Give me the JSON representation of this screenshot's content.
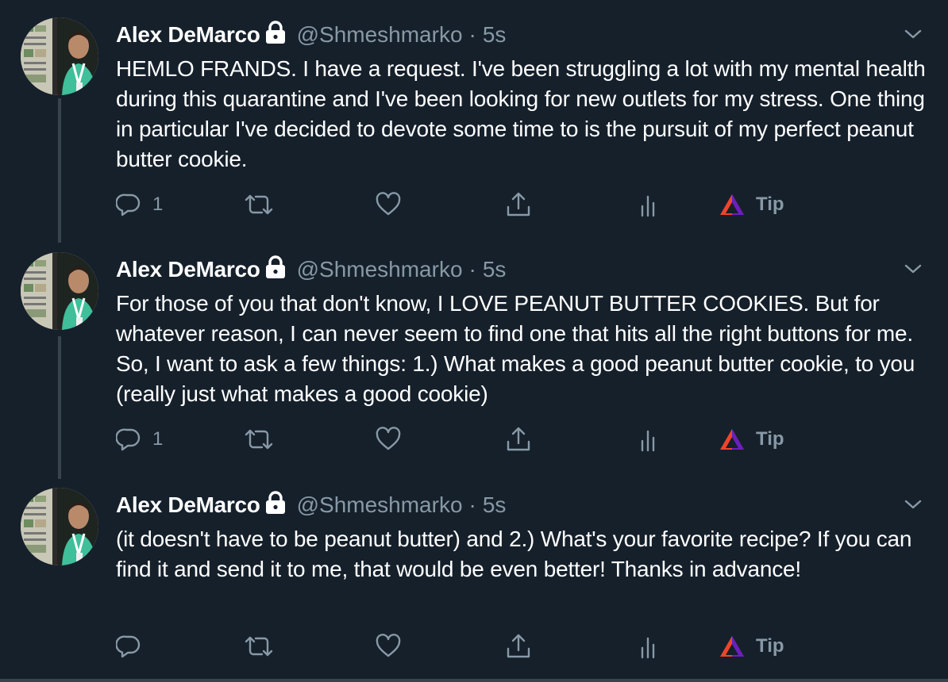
{
  "tweets": [
    {
      "name": "Alex DeMarco",
      "handle": "@Shmeshmarko",
      "separator": "·",
      "time": "5s",
      "text": "HEMLO FRANDS. I have a request. I've been struggling a lot with my mental health during this quarantine and I've been looking for new outlets for my stress. One thing in particular I've decided to devote some time to is the pursuit of my perfect peanut butter cookie.",
      "reply_count": "1",
      "tip_label": "Tip"
    },
    {
      "name": "Alex DeMarco",
      "handle": "@Shmeshmarko",
      "separator": "·",
      "time": "5s",
      "text": "For those of you that don't know, I LOVE PEANUT BUTTER COOKIES. But for whatever reason, I can never seem to find one that hits all the right buttons for me. So, I want to ask a few things: 1.) What makes a good peanut butter cookie, to you (really just what makes a good cookie)",
      "reply_count": "1",
      "tip_label": "Tip"
    },
    {
      "name": "Alex DeMarco",
      "handle": "@Shmeshmarko",
      "separator": "·",
      "time": "5s",
      "text": "(it doesn't have to be peanut butter) and 2.) What's your favorite recipe? If you can find it and send it to me, that would be even better! Thanks in advance!",
      "reply_count": "",
      "tip_label": "Tip"
    }
  ],
  "icons": {
    "lock": "lock-icon",
    "caret": "chevron-down-icon",
    "reply": "reply-icon",
    "retweet": "retweet-icon",
    "like": "heart-icon",
    "share": "share-icon",
    "analytics": "analytics-icon",
    "tip": "brave-tip-icon"
  },
  "colors": {
    "background": "#15202b",
    "text": "#ffffff",
    "secondary": "#8899a6",
    "thread_line": "#38444d"
  }
}
